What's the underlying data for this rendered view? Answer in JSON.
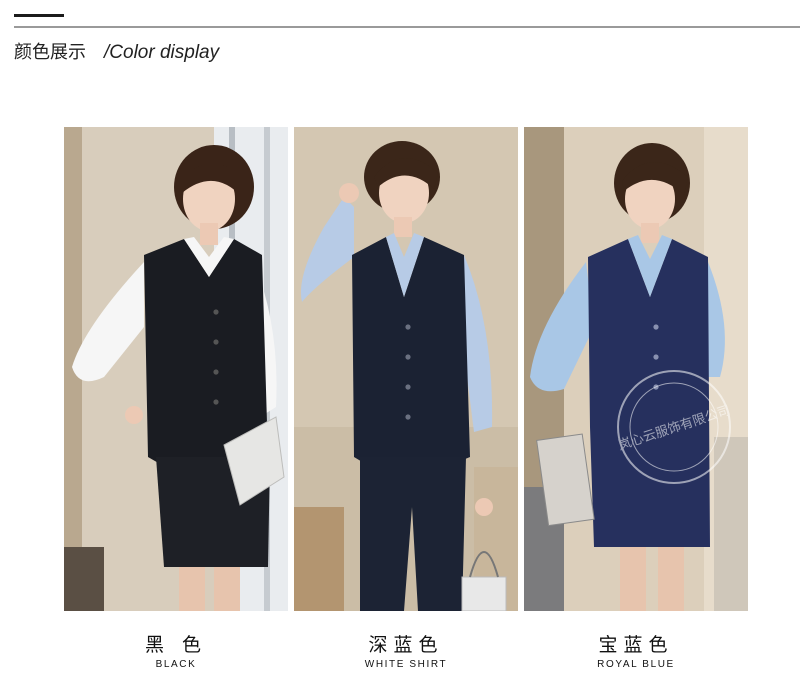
{
  "header": {
    "title_zh": "颜色展示",
    "title_en": "/Color display"
  },
  "swatches": [
    {
      "name_zh": "黑 色",
      "name_en": "BLACK",
      "vest_color": "#1a1c22",
      "shirt_color": "#f4f4f4",
      "skirt": true
    },
    {
      "name_zh": "深蓝色",
      "name_en": "WHITE SHIRT",
      "vest_color": "#1b2233",
      "shirt_color": "#b7cbe6",
      "skirt": false
    },
    {
      "name_zh": "宝蓝色",
      "name_en": "ROYAL BLUE",
      "vest_color": "#26305e",
      "shirt_color": "#a9c7e6",
      "skirt": true
    }
  ],
  "watermark": {
    "text": "岚心云服饰有限公司"
  }
}
